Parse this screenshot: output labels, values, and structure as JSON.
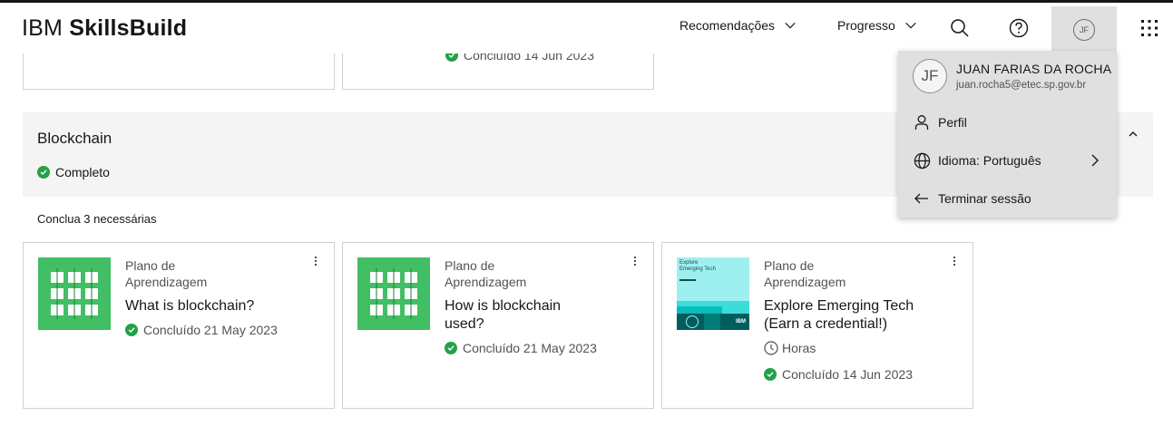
{
  "brand": {
    "prefix": "IBM",
    "name": "SkillsBuild"
  },
  "nav": {
    "recommendations": "Recomendações",
    "progress": "Progresso",
    "avatar_initials": "JF"
  },
  "top_cards": [
    {
      "status": "Concluído 14 Jun 2023"
    }
  ],
  "section": {
    "title": "Blockchain",
    "status": "Completo",
    "requirement": "Conclua 3 necessárias"
  },
  "cards": [
    {
      "type": "Plano de Aprendizagem",
      "title": "What is blockchain?",
      "status": "Concluído 21 May 2023",
      "thumb": "green-grid"
    },
    {
      "type": "Plano de Aprendizagem",
      "title": "How is blockchain used?",
      "status": "Concluído 21 May 2023",
      "thumb": "green-grid"
    },
    {
      "type": "Plano de Aprendizagem",
      "title": "Explore Emerging Tech (Earn a credential!)",
      "hours": "Horas",
      "status": "Concluído 14 Jun 2023",
      "thumb": "emerging-tech",
      "thumb_text": {
        "line1": "Explore",
        "line2": "Emerging Tech",
        "logo": "IBM"
      }
    }
  ],
  "user_menu": {
    "initials": "JF",
    "name": "JUAN FARIAS DA ROCHA",
    "email": "juan.rocha5@etec.sp.gov.br",
    "items": [
      {
        "label": "Perfil",
        "icon": "user-icon"
      },
      {
        "label": "Idioma: Português",
        "icon": "globe-icon"
      },
      {
        "label": "Terminar sessão",
        "icon": "arrow-left-icon"
      }
    ]
  },
  "colors": {
    "success": "#24a148",
    "thumb_green": "#42be65",
    "menu_bg": "#e0e0e0",
    "section_bg": "#f4f4f4"
  }
}
